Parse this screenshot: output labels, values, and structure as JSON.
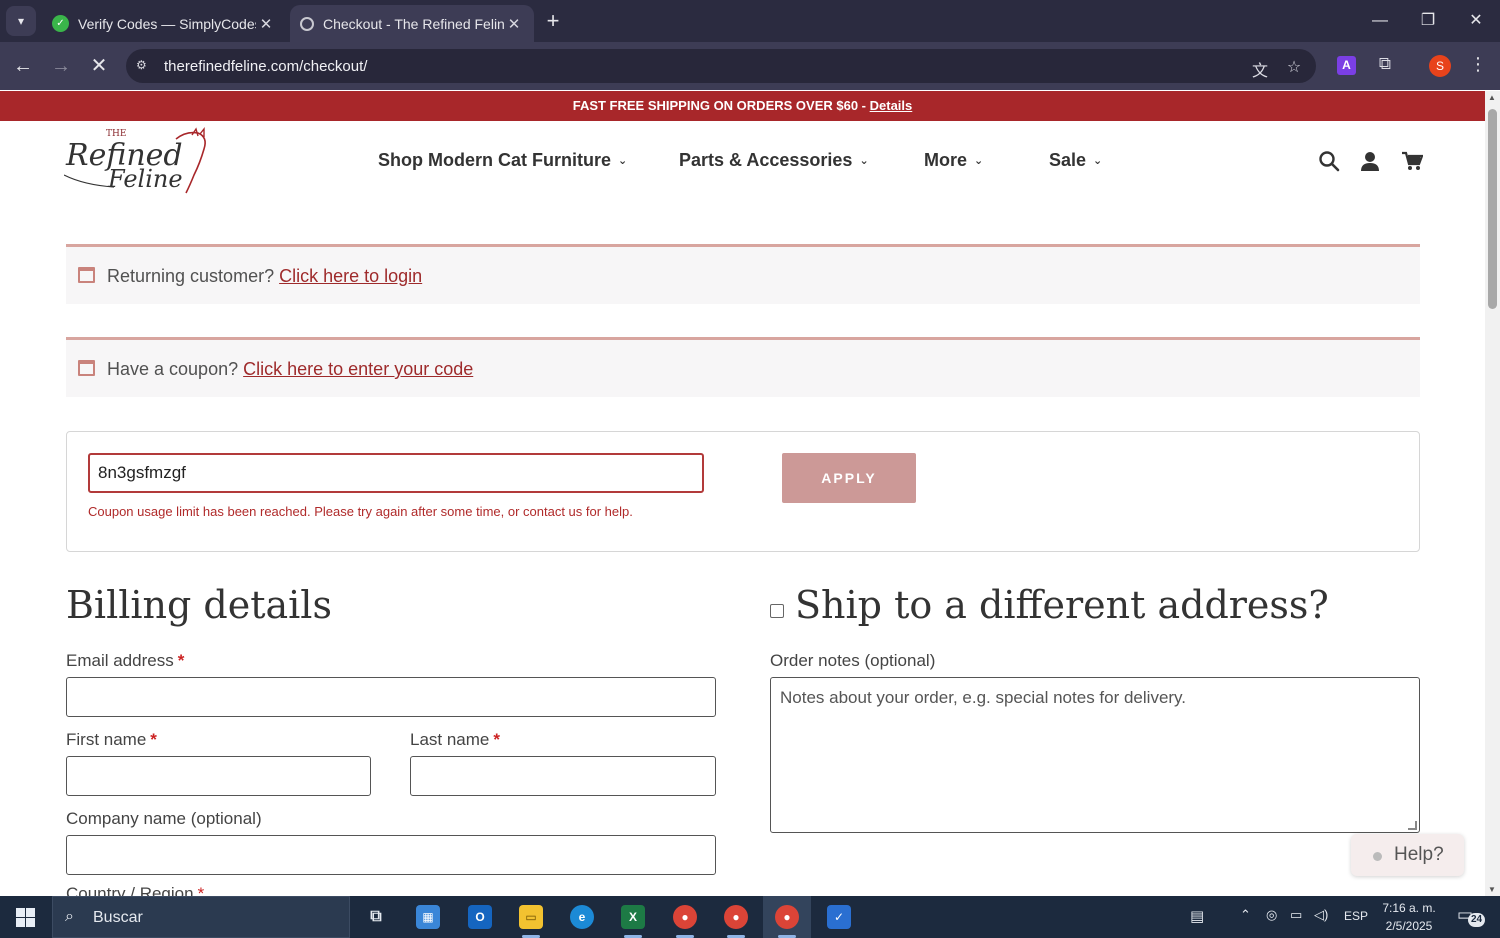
{
  "browser": {
    "tabs": [
      {
        "title": "Verify Codes — SimplyCodes",
        "favicon": "simplycodes-icon",
        "active": false
      },
      {
        "title": "Checkout - The Refined Feline",
        "favicon": "refined-feline-icon",
        "active": true
      }
    ],
    "url": "therefinedfeline.com/checkout/",
    "profile_initial": "S",
    "extension_letter": "A"
  },
  "promo": {
    "text": "FAST FREE SHIPPING ON ORDERS OVER $60 - ",
    "link": "Details"
  },
  "header": {
    "logo_small": "THE",
    "logo_line1": "Refined",
    "logo_line2": "Feline",
    "nav": [
      {
        "label": "Shop Modern Cat Furniture"
      },
      {
        "label": "Parts & Accessories"
      },
      {
        "label": "More"
      },
      {
        "label": "Sale"
      }
    ]
  },
  "notices": {
    "login_text": "Returning customer?",
    "login_link": "Click here to login",
    "coupon_text": "Have a coupon?",
    "coupon_link": "Click here to enter your code"
  },
  "coupon": {
    "value": "8n3gsfmzgf",
    "error": "Coupon usage limit has been reached. Please try again after some time, or contact us for help.",
    "apply_label": "APPLY"
  },
  "billing": {
    "heading": "Billing details",
    "email_label": "Email address",
    "first_name_label": "First name",
    "last_name_label": "Last name",
    "company_label": "Company name (optional)",
    "country_label": "Country / Region",
    "required_mark": "*"
  },
  "shipping": {
    "heading": "Ship to a different address?",
    "notes_label": "Order notes (optional)",
    "notes_placeholder": "Notes about your order, e.g. special notes for delivery."
  },
  "help": {
    "label": "Help?"
  },
  "taskbar": {
    "search_placeholder": "Buscar",
    "language": "ESP",
    "time": "7:16 a. m.",
    "date": "2/5/2025",
    "notification_count": "24"
  },
  "colors": {
    "brand_red": "#a8272a",
    "link_red": "#9e2a2b",
    "apply_button": "#cc9997",
    "notice_border": "#d8a59f"
  }
}
